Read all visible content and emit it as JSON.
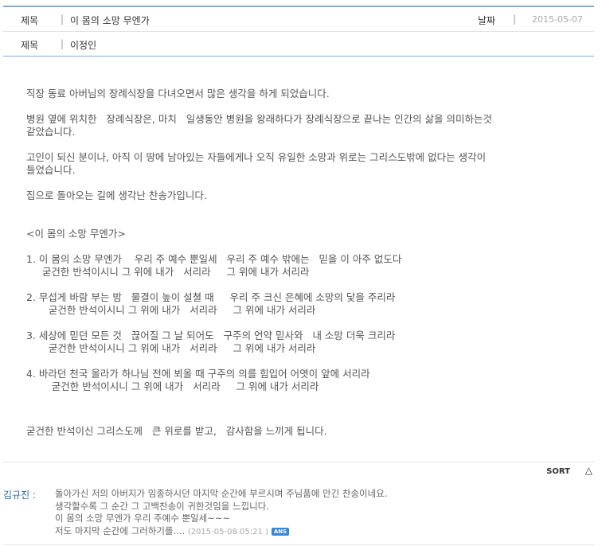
{
  "header": {
    "title_label": "제목",
    "title_value": "이 몸의 소망 무엔가",
    "date_label": "날짜",
    "date_value": "2015-05-07",
    "author_label": "제목",
    "author_value": "이정인"
  },
  "content": {
    "intro": [
      "직장 동료 아버님의 장례식장을 다녀오면서 많은 생각을 하게 되었습니다.",
      "병원 옆에 위치한   장례식장은, 마치   일생동안 병원을 왕래하다가 장례식장으로 끝나는 인간의 삶을 의미하는것",
      "같았습니다.",
      "고인이 되신 분이나, 아직 이 땅에 남아있는 자들에게나 오직 유일한 소망과 위로는 그리스도밖에 없다는 생각이",
      "들었습니다.",
      "집으로 돌아오는 길에 생각난 찬송가입니다."
    ],
    "song_title": "<이 몸의 소망 무엔가>",
    "verses": [
      {
        "line1": "1. 이 몸의 소망 무엔가    우리 주 예수 뿐일세   우리 주 예수 밖에는   믿을 이 아주 없도다",
        "line2": "     굳건한 반석이시니 그 위에 내가   서리라     그 위에 내가 서리라"
      },
      {
        "line1": "2. 무섭게 바람 부는 밤   물결이 높이 설쳘 때     우리 주 크신 은혜에 소망의 닻을 주리라",
        "line2": "       굳건한 반석이시니 그 위에 내가   서리라     그 위에 내가 서리라"
      },
      {
        "line1": "3. 세상에 믿던 모든 것   끊어질 그 날 되어도   구주의 언약 믿사와   내 소망 더욱 크리라",
        "line2": "       굳건한 반석이시니 그 위에 내가   서리라     그 위에 내가 서리라"
      },
      {
        "line1": "4. 바라던 천국 올라가 하나님 전에 뵈올 때 구주의 의를 힘입어 어엿이 앞에 서리라",
        "line2": "        굳건한 반석이시니 그 위에 내가   서리라     그 위에 내가 서리라"
      }
    ],
    "closing": "굳건한 반석이신 그리스도께   큰 위로를 받고,   감사함을 느끼게 됩니다."
  },
  "sort": {
    "label": "SORT",
    "icon": "triangle-up-icon"
  },
  "comment": {
    "author": "김규진 :",
    "lines": [
      "돌아가신 저의 아버지가 임종하시던 마지막 순간에 부르시며 주님품에 안긴 찬송이네요.",
      "생각할수록 그 순간 그 고백찬송이 귀한것임을 느낍니다.",
      "이 몸의 소망 무엔가 우리 주예수 뿐일세~~~",
      "저도 마지막 순간에 그러하기를...."
    ],
    "timestamp": "(2015-05-08 05:21 )",
    "badge": "ANS"
  }
}
